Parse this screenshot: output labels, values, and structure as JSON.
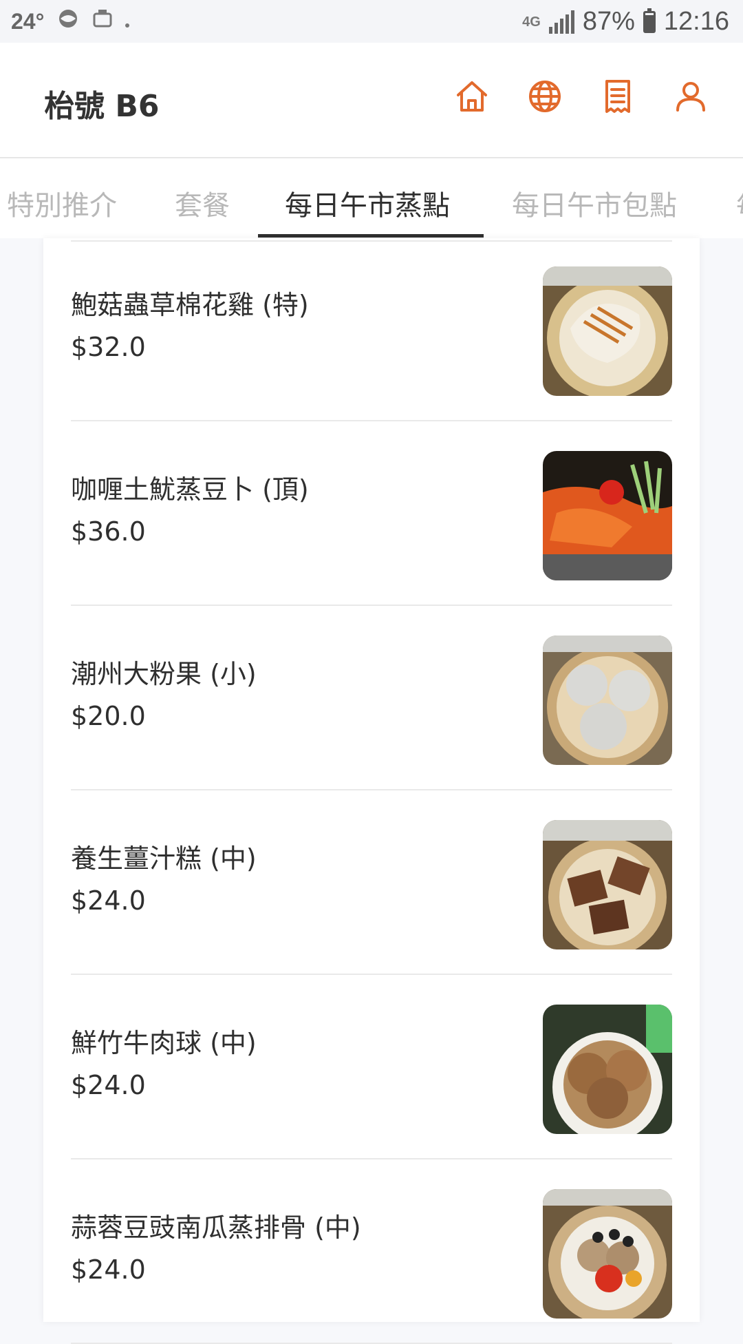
{
  "status_bar": {
    "temperature": "24°",
    "network": "4G",
    "battery_percent": "87%",
    "battery_level": 0.87,
    "time": "12:16"
  },
  "header": {
    "title": "枱號 B6",
    "icons": [
      "home-icon",
      "globe-icon",
      "receipt-icon",
      "user-icon"
    ],
    "accent_color": "#e26a2c"
  },
  "tabs": [
    {
      "label": "特別推介",
      "active": false
    },
    {
      "label": "套餐",
      "active": false
    },
    {
      "label": "每日午市蒸點",
      "active": true
    },
    {
      "label": "每日午市包點",
      "active": false
    },
    {
      "label": "每",
      "active": false
    }
  ],
  "menu_items": [
    {
      "name": "鮑菇蟲草棉花雞 (特)",
      "price": "$32.0"
    },
    {
      "name": "咖喱土魷蒸豆卜 (頂)",
      "price": "$36.0"
    },
    {
      "name": "潮州大粉果 (小)",
      "price": "$20.0"
    },
    {
      "name": "養生薑汁糕 (中)",
      "price": "$24.0"
    },
    {
      "name": "鮮竹牛肉球 (中)",
      "price": "$24.0"
    },
    {
      "name": "蒜蓉豆豉南瓜蒸排骨 (中)",
      "price": "$24.0"
    }
  ]
}
